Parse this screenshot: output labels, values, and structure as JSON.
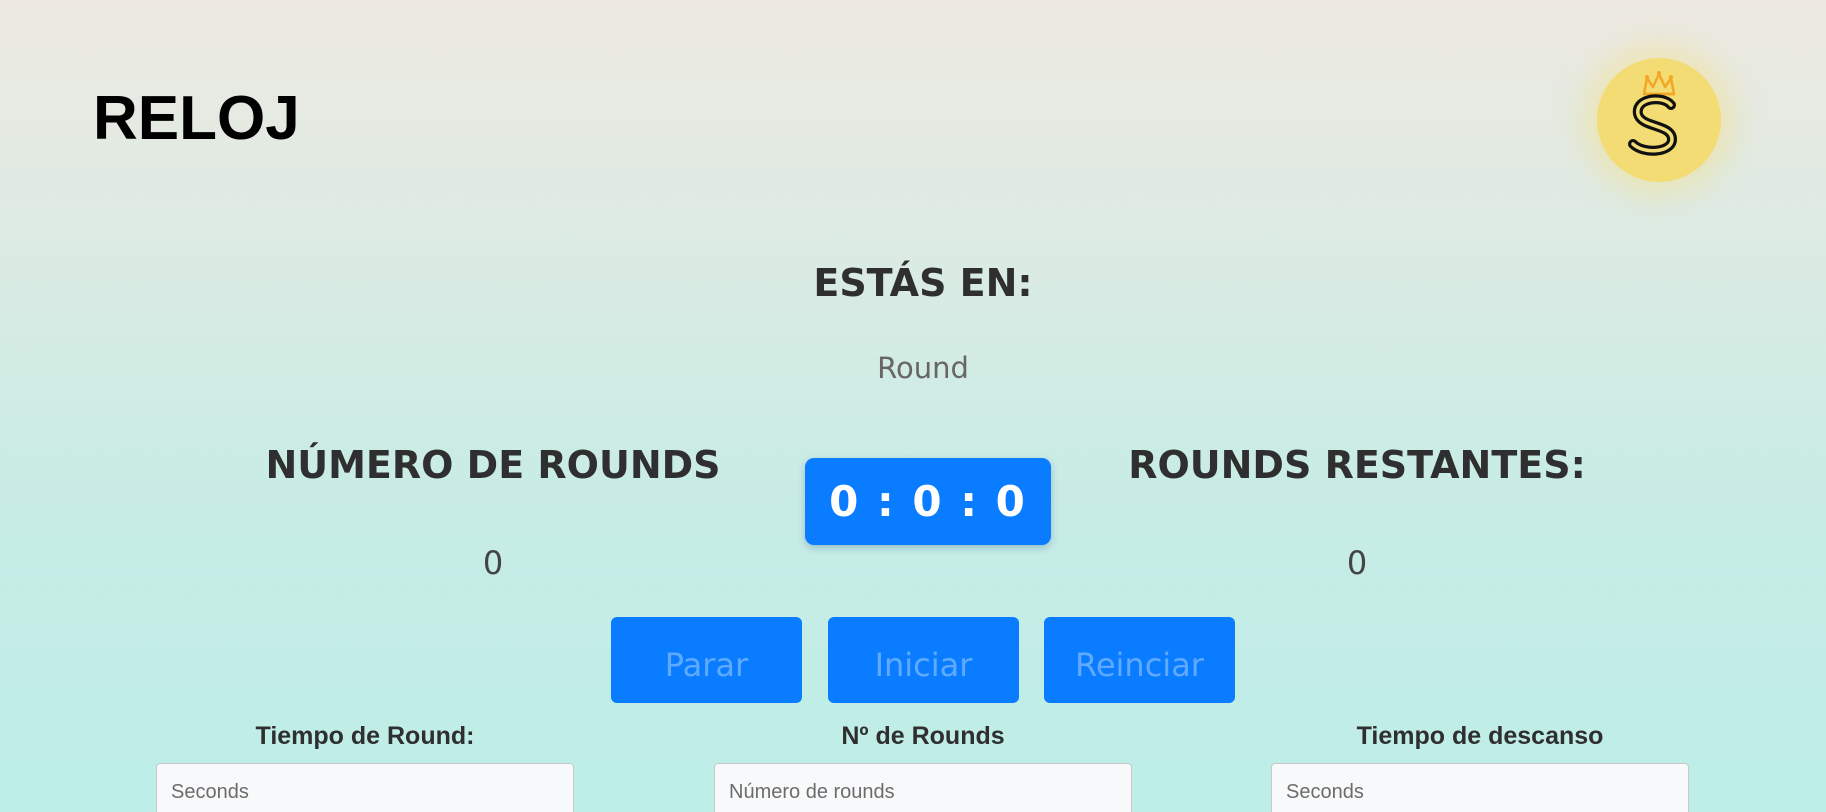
{
  "header": {
    "title": "RELOJ",
    "logo_icon": "crowned-s-logo"
  },
  "status": {
    "heading": "ESTÁS EN:",
    "phase": "Round"
  },
  "stats": {
    "rounds_heading": "NÚMERO DE ROUNDS",
    "rounds_value": "0",
    "remaining_heading": "ROUNDS RESTANTES:",
    "remaining_value": "0"
  },
  "timer": {
    "display": "0 : 0 : 0"
  },
  "controls": {
    "stop_label": "Parar",
    "start_label": "Iniciar",
    "reset_label": "Reinciar"
  },
  "settings": {
    "round_time_label": "Tiempo de Round:",
    "round_time_value": "",
    "round_time_placeholder": "Seconds",
    "rounds_label": "Nº de Rounds",
    "rounds_value": "",
    "rounds_placeholder": "Número de rounds",
    "rest_time_label": "Tiempo de descanso",
    "rest_time_value": "",
    "rest_time_placeholder": "Seconds"
  },
  "colors": {
    "accent": "#0a7cff",
    "logo_bg": "#f2dc73",
    "crown": "#f5a623"
  }
}
